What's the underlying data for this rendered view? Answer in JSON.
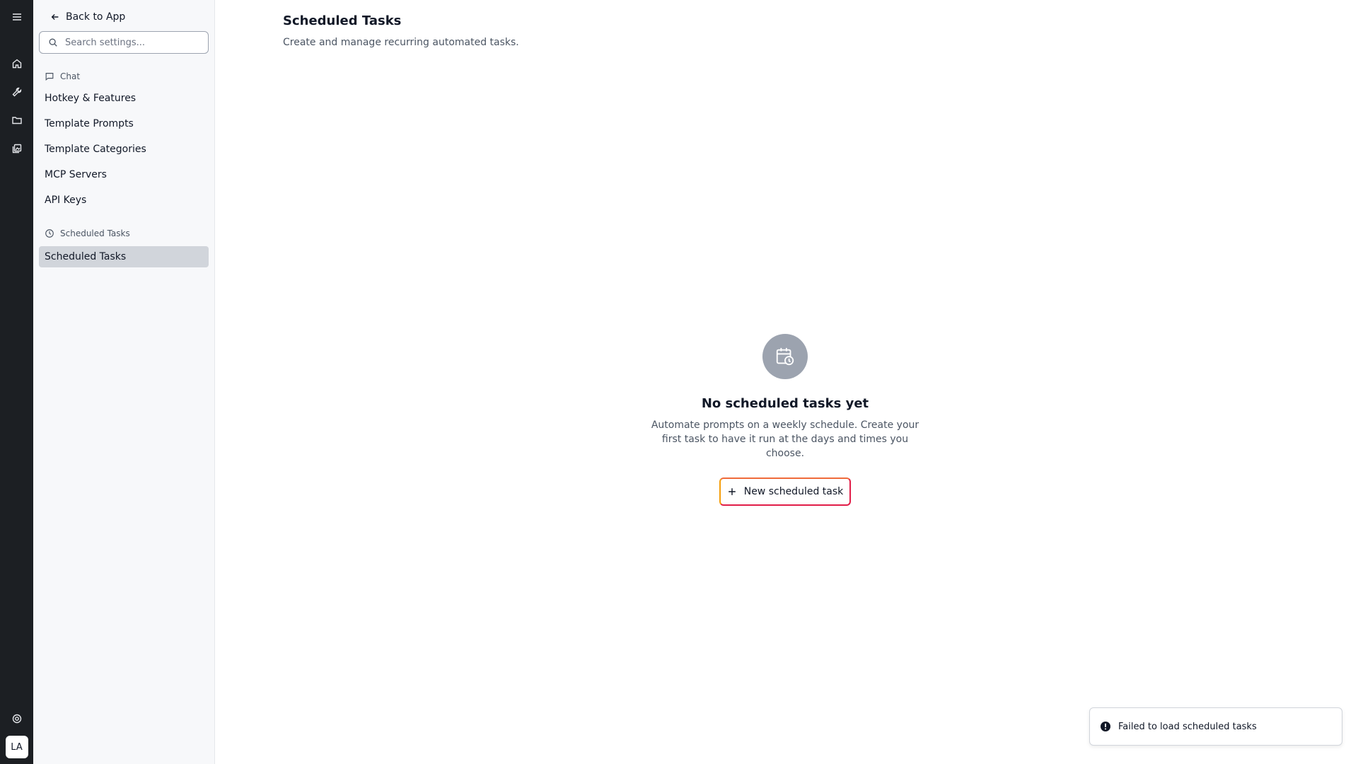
{
  "rail": {
    "icons": [
      "menu-icon",
      "home-icon",
      "wrench-icon",
      "folder-icon",
      "gallery-icon",
      "help-icon"
    ],
    "avatar_initials": "LA"
  },
  "sidebar": {
    "back_label": "Back to App",
    "search_placeholder": "Search settings...",
    "groups": [
      {
        "label": "Chat",
        "icon": "chat-bubble-icon",
        "items": [
          {
            "label": "Hotkey & Features"
          },
          {
            "label": "Template Prompts"
          },
          {
            "label": "Template Categories"
          },
          {
            "label": "MCP Servers"
          },
          {
            "label": "API Keys"
          }
        ]
      },
      {
        "label": "Scheduled Tasks",
        "icon": "clock-icon",
        "items": [
          {
            "label": "Scheduled Tasks",
            "active": true
          }
        ]
      }
    ]
  },
  "main": {
    "title": "Scheduled Tasks",
    "subtitle": "Create and manage recurring automated tasks.",
    "empty_state": {
      "icon": "calendar-clock-icon",
      "title": "No scheduled tasks yet",
      "description": "Automate prompts on a weekly schedule. Create your first task to have it run at the days and times you choose.",
      "button_label": "New scheduled task"
    }
  },
  "toast": {
    "message": "Failed to load scheduled tasks",
    "icon": "alert-circle-icon"
  },
  "colors": {
    "rail_bg": "#1c1f23",
    "sidebar_bg": "#f7f8fa",
    "active_item": "#d1d5db",
    "button_border_gradient": [
      "#f59e0b",
      "#e11d48"
    ]
  }
}
